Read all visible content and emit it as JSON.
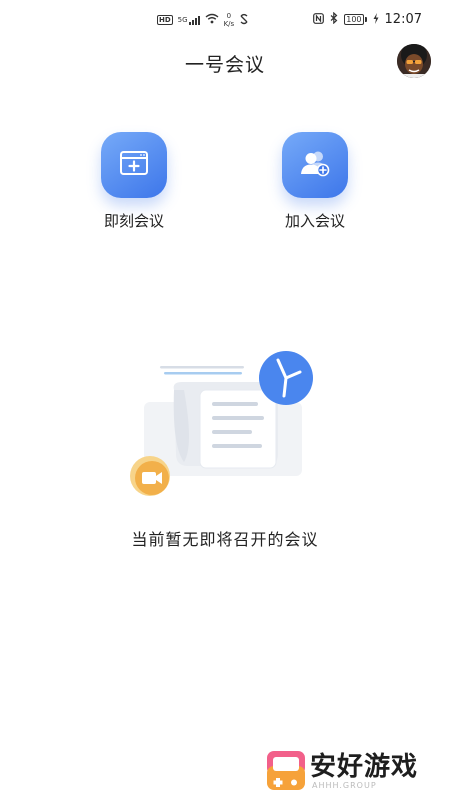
{
  "status_bar": {
    "hd": "HD",
    "network_gen": "5G",
    "speed_value": "0",
    "speed_unit": "K/s",
    "battery": "100",
    "time": "12:07"
  },
  "header": {
    "title": "一号会议"
  },
  "actions": [
    {
      "label": "即刻会议",
      "icon": "new-meeting-icon"
    },
    {
      "label": "加入会议",
      "icon": "join-meeting-icon"
    }
  ],
  "empty_state": {
    "message": "当前暂无即将召开的会议"
  },
  "watermark": {
    "text": "安好游戏",
    "sub": "AHHH.GROUP"
  },
  "colors": {
    "accent_start": "#76aaf8",
    "accent_end": "#3d76ea",
    "clock_blue": "#4a86ee",
    "camera_orange": "#f2b04a"
  }
}
